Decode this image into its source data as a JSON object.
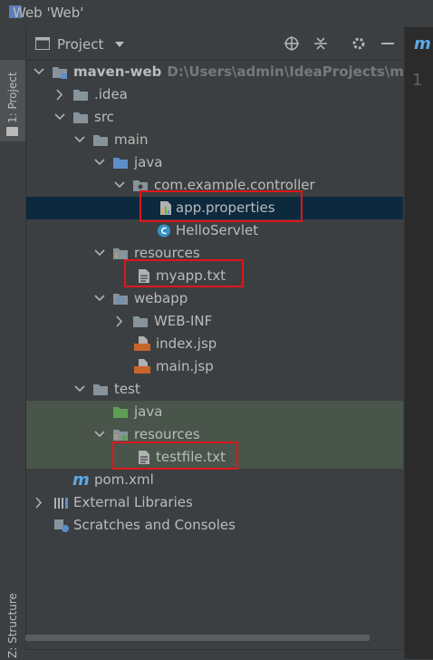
{
  "window": {
    "title": "Web 'Web'"
  },
  "left_tabs": {
    "project": "1: Project",
    "structure": "Z: Structure"
  },
  "panel": {
    "title": "Project"
  },
  "tree": [
    {
      "label": "maven-web",
      "sub": "D:\\Users\\admin\\IdeaProjects\\maven-",
      "icon": "module-folder-icon"
    },
    {
      "label": ".idea",
      "icon": "folder-icon"
    },
    {
      "label": "src",
      "icon": "folder-icon"
    },
    {
      "label": "main",
      "icon": "folder-icon"
    },
    {
      "label": "java",
      "icon": "source-folder-icon"
    },
    {
      "label": "com.example.controller",
      "icon": "package-icon"
    },
    {
      "label": "app.properties",
      "icon": "properties-file-icon"
    },
    {
      "label": "HelloServlet",
      "icon": "class-icon"
    },
    {
      "label": "resources",
      "icon": "resources-folder-icon"
    },
    {
      "label": "myapp.txt",
      "icon": "text-file-icon"
    },
    {
      "label": "webapp",
      "icon": "web-folder-icon"
    },
    {
      "label": "WEB-INF",
      "icon": "folder-icon"
    },
    {
      "label": "index.jsp",
      "icon": "jsp-file-icon"
    },
    {
      "label": "main.jsp",
      "icon": "jsp-file-icon"
    },
    {
      "label": "test",
      "icon": "folder-icon"
    },
    {
      "label": "java",
      "icon": "test-source-folder-icon"
    },
    {
      "label": "resources",
      "icon": "test-resources-folder-icon"
    },
    {
      "label": "testfile.txt",
      "icon": "text-file-icon"
    },
    {
      "label": "pom.xml",
      "icon": "maven-icon"
    },
    {
      "label": "External Libraries",
      "icon": "libraries-icon"
    },
    {
      "label": "Scratches and Consoles",
      "icon": "scratches-icon"
    }
  ],
  "editor": {
    "tab_glyph": "m",
    "line_number": "1"
  },
  "colors": {
    "selection": "#0d293e",
    "test_bg": "#49544a",
    "highlight_box": "#e0161b",
    "folder": "#87939a",
    "source": "#5d8ecb",
    "test": "#5f9e56"
  }
}
